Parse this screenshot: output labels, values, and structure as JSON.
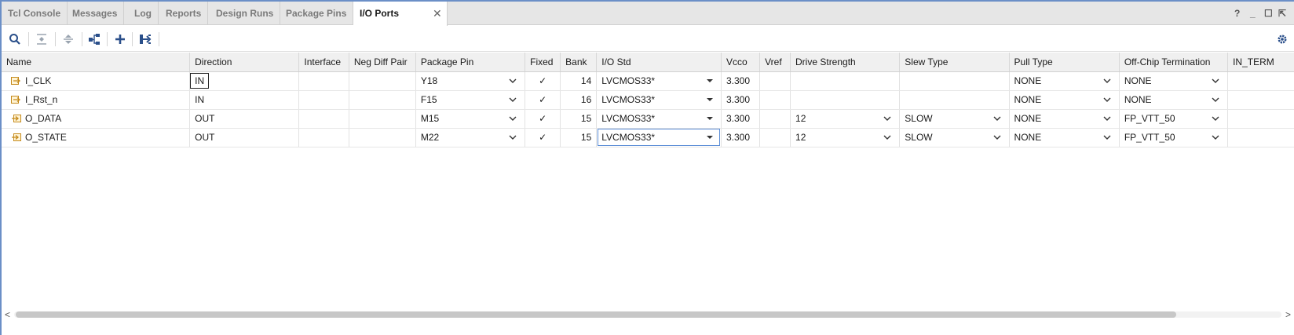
{
  "tabs": [
    {
      "label": "Tcl Console"
    },
    {
      "label": "Messages"
    },
    {
      "label": "Log"
    },
    {
      "label": "Reports"
    },
    {
      "label": "Design Runs"
    },
    {
      "label": "Package Pins"
    },
    {
      "label": "I/O Ports"
    }
  ],
  "active_tab": "I/O Ports",
  "window_controls": {
    "help": "?",
    "minimize": "_",
    "maximize": "☐",
    "float": "⇱"
  },
  "toolbar": {
    "icons": [
      "search-icon",
      "collapse-all-icon",
      "expand-all-icon",
      "group-icon",
      "add-icon",
      "export-icon",
      "settings-icon"
    ]
  },
  "columns": [
    "Name",
    "Direction",
    "Interface",
    "Neg Diff Pair",
    "Package Pin",
    "Fixed",
    "Bank",
    "I/O Std",
    "Vcco",
    "Vref",
    "Drive Strength",
    "Slew Type",
    "Pull Type",
    "Off-Chip Termination",
    "IN_TERM"
  ],
  "rows": [
    {
      "name": "I_CLK",
      "dir": "IN",
      "iface": "",
      "neg": "",
      "pin": "Y18",
      "fixed": "✓",
      "bank": "14",
      "iostd": "LVCMOS33*",
      "vcco": "3.300",
      "vref": "",
      "drive": "",
      "slew": "",
      "pull": "NONE",
      "term": "NONE",
      "interm": ""
    },
    {
      "name": "I_Rst_n",
      "dir": "IN",
      "iface": "",
      "neg": "",
      "pin": "F15",
      "fixed": "✓",
      "bank": "16",
      "iostd": "LVCMOS33*",
      "vcco": "3.300",
      "vref": "",
      "drive": "",
      "slew": "",
      "pull": "NONE",
      "term": "NONE",
      "interm": ""
    },
    {
      "name": "O_DATA",
      "dir": "OUT",
      "iface": "",
      "neg": "",
      "pin": "M15",
      "fixed": "✓",
      "bank": "15",
      "iostd": "LVCMOS33*",
      "vcco": "3.300",
      "vref": "",
      "drive": "12",
      "slew": "SLOW",
      "pull": "NONE",
      "term": "FP_VTT_50",
      "interm": ""
    },
    {
      "name": "O_STATE",
      "dir": "OUT",
      "iface": "",
      "neg": "",
      "pin": "M22",
      "fixed": "✓",
      "bank": "15",
      "iostd": "LVCMOS33*",
      "vcco": "3.300",
      "vref": "",
      "drive": "12",
      "slew": "SLOW",
      "pull": "NONE",
      "term": "FP_VTT_50",
      "interm": ""
    }
  ],
  "scroll": {
    "left": "<",
    "right": ">"
  },
  "colors": {
    "accent": "#6b8fc7",
    "icon_blue": "#2a4f8a",
    "input_port": "#c58a1b",
    "output_port": "#c58a1b"
  }
}
